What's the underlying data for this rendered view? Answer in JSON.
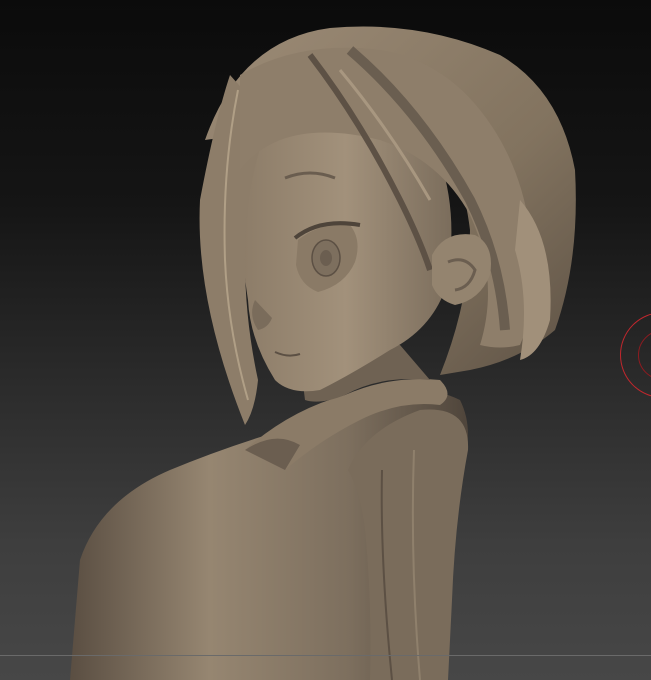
{
  "viewport": {
    "background_top": "#0b0b0b",
    "background_bottom": "#474747"
  },
  "model": {
    "material_base": "#8a7a68",
    "material_light": "#a8977f",
    "material_shadow": "#5a4e42"
  },
  "brush_cursor": {
    "color": "#c1272d"
  }
}
